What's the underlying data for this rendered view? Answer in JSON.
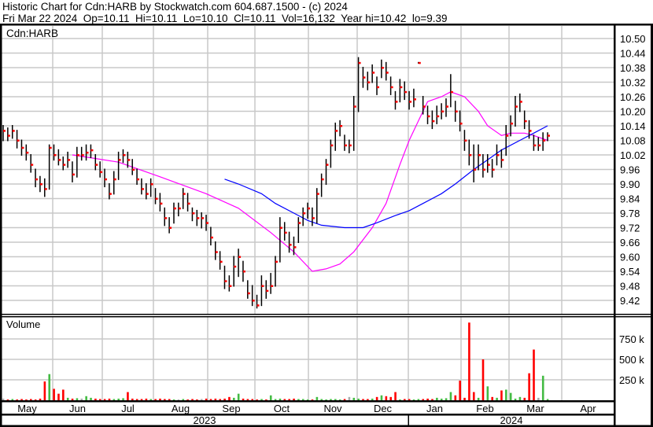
{
  "header": {
    "title": "Historic Chart for Cdn:HARB by Stockwatch.com 604.687.1500 - (c) 2024",
    "quote": "Fri Mar 22 2024  Op=10.11  Hi=10.11  Lo=10.10  Cl=10.11  Vol=16,132  Year hi=10.42  lo=9.39"
  },
  "chart_data": {
    "type": "ohlc",
    "symbol_label": "Cdn:HARB",
    "volume_label": "Volume",
    "price_axis": {
      "ylim": [
        9.36,
        10.56
      ],
      "ticks": [
        "10.50",
        "10.44",
        "10.38",
        "10.32",
        "10.26",
        "10.20",
        "10.14",
        "10.08",
        "10.02",
        "9.96",
        "9.90",
        "9.84",
        "9.78",
        "9.72",
        "9.66",
        "9.60",
        "9.54",
        "9.48",
        "9.42"
      ],
      "side": "right",
      "grid": true
    },
    "volume_axis": {
      "ylim_k": [
        0,
        1000
      ],
      "ticks": [
        {
          "value": 750,
          "label": "750 k"
        },
        {
          "value": 500,
          "label": "500 k"
        },
        {
          "value": 250,
          "label": "250 k"
        }
      ]
    },
    "months": [
      "May",
      "Jun",
      "Jul",
      "Aug",
      "Sep",
      "Oct",
      "Nov",
      "Dec",
      "Jan",
      "Feb",
      "Mar",
      "Apr"
    ],
    "years": [
      "2023",
      "2024"
    ],
    "colors": {
      "close_tick": "#ff0000",
      "bar": "#000000",
      "ma_short": "#ff00ff",
      "ma_long": "#0000ff",
      "vol_up": "#44bb44",
      "vol_down": "#ff0000",
      "vol_flat": "#aaaaaa",
      "grid": "#c8c8c8"
    },
    "bars_hlc": [
      [
        10.14,
        10.08,
        10.12
      ],
      [
        10.13,
        10.08,
        10.1
      ],
      [
        10.14,
        10.09,
        10.12
      ],
      [
        10.12,
        10.05,
        10.08
      ],
      [
        10.08,
        10.02,
        10.05
      ],
      [
        10.06,
        10.0,
        10.03
      ],
      [
        10.02,
        9.95,
        9.98
      ],
      [
        9.96,
        9.89,
        9.92
      ],
      [
        9.93,
        9.87,
        9.9
      ],
      [
        9.92,
        9.85,
        9.88
      ],
      [
        10.06,
        9.88,
        10.05
      ],
      [
        10.06,
        10.0,
        10.02
      ],
      [
        10.04,
        9.98,
        10.0
      ],
      [
        10.01,
        9.96,
        9.98
      ],
      [
        10.03,
        9.97,
        10.0
      ],
      [
        9.99,
        9.91,
        9.94
      ],
      [
        10.05,
        9.93,
        10.02
      ],
      [
        10.05,
        10.0,
        10.02
      ],
      [
        10.06,
        10.0,
        10.03
      ],
      [
        10.06,
        10.01,
        10.04
      ],
      [
        10.02,
        9.96,
        9.98
      ],
      [
        9.99,
        9.93,
        9.95
      ],
      [
        9.96,
        9.89,
        9.92
      ],
      [
        9.9,
        9.84,
        9.86
      ],
      [
        9.95,
        9.86,
        9.92
      ],
      [
        10.03,
        9.92,
        10.0
      ],
      [
        10.04,
        9.99,
        10.02
      ],
      [
        10.03,
        9.97,
        10.0
      ],
      [
        10.0,
        9.94,
        9.96
      ],
      [
        9.96,
        9.9,
        9.92
      ],
      [
        9.92,
        9.86,
        9.88
      ],
      [
        9.9,
        9.84,
        9.86
      ],
      [
        9.92,
        9.85,
        9.9
      ],
      [
        9.88,
        9.82,
        9.84
      ],
      [
        9.86,
        9.79,
        9.82
      ],
      [
        9.8,
        9.73,
        9.76
      ],
      [
        9.76,
        9.7,
        9.72
      ],
      [
        9.82,
        9.74,
        9.8
      ],
      [
        9.82,
        9.77,
        9.8
      ],
      [
        9.88,
        9.8,
        9.86
      ],
      [
        9.86,
        9.79,
        9.82
      ],
      [
        9.8,
        9.75,
        9.78
      ],
      [
        9.79,
        9.73,
        9.76
      ],
      [
        9.78,
        9.72,
        9.76
      ],
      [
        9.77,
        9.71,
        9.74
      ],
      [
        9.72,
        9.65,
        9.68
      ],
      [
        9.66,
        9.59,
        9.62
      ],
      [
        9.62,
        9.55,
        9.58
      ],
      [
        9.56,
        9.47,
        9.5
      ],
      [
        9.52,
        9.46,
        9.48
      ],
      [
        9.6,
        9.48,
        9.56
      ],
      [
        9.63,
        9.52,
        9.6
      ],
      [
        9.58,
        9.5,
        9.54
      ],
      [
        9.5,
        9.43,
        9.45
      ],
      [
        9.48,
        9.4,
        9.42
      ],
      [
        9.44,
        9.39,
        9.4
      ],
      [
        9.52,
        9.4,
        9.48
      ],
      [
        9.5,
        9.43,
        9.46
      ],
      [
        9.53,
        9.45,
        9.48
      ],
      [
        9.6,
        9.48,
        9.58
      ],
      [
        9.76,
        9.58,
        9.72
      ],
      [
        9.74,
        9.67,
        9.7
      ],
      [
        9.7,
        9.62,
        9.65
      ],
      [
        9.68,
        9.61,
        9.64
      ],
      [
        9.76,
        9.66,
        9.74
      ],
      [
        9.8,
        9.73,
        9.78
      ],
      [
        9.82,
        9.76,
        9.8
      ],
      [
        9.8,
        9.73,
        9.76
      ],
      [
        9.88,
        9.74,
        9.86
      ],
      [
        9.94,
        9.85,
        9.92
      ],
      [
        10.0,
        9.9,
        9.98
      ],
      [
        10.08,
        9.97,
        10.06
      ],
      [
        10.15,
        10.04,
        10.12
      ],
      [
        10.16,
        10.1,
        10.14
      ],
      [
        10.1,
        10.04,
        10.06
      ],
      [
        10.08,
        10.03,
        10.06
      ],
      [
        10.26,
        10.04,
        10.22
      ],
      [
        10.42,
        10.2,
        10.4
      ],
      [
        10.38,
        10.3,
        10.34
      ],
      [
        10.36,
        10.29,
        10.32
      ],
      [
        10.39,
        10.32,
        10.36
      ],
      [
        10.34,
        10.27,
        10.3
      ],
      [
        10.41,
        10.34,
        10.38
      ],
      [
        10.4,
        10.33,
        10.36
      ],
      [
        10.34,
        10.27,
        10.3
      ],
      [
        10.28,
        10.21,
        10.24
      ],
      [
        10.33,
        10.24,
        10.3
      ],
      [
        10.32,
        10.25,
        10.28
      ],
      [
        10.28,
        10.21,
        10.24
      ],
      [
        10.29,
        10.22,
        10.25
      ],
      [
        10.4,
        10.4,
        10.4
      ],
      [
        10.26,
        10.19,
        10.22
      ],
      [
        10.22,
        10.15,
        10.18
      ],
      [
        10.2,
        10.13,
        10.16
      ],
      [
        10.22,
        10.15,
        10.18
      ],
      [
        10.23,
        10.17,
        10.2
      ],
      [
        10.25,
        10.18,
        10.22
      ],
      [
        10.35,
        10.22,
        10.28
      ],
      [
        10.24,
        10.16,
        10.2
      ],
      [
        10.2,
        10.12,
        10.15
      ],
      [
        10.12,
        10.04,
        10.08
      ],
      [
        10.08,
        9.98,
        10.02
      ],
      [
        10.06,
        9.91,
        9.96
      ],
      [
        10.06,
        9.96,
        10.02
      ],
      [
        10.02,
        9.93,
        9.96
      ],
      [
        10.02,
        9.95,
        9.98
      ],
      [
        10.0,
        9.93,
        9.96
      ],
      [
        10.06,
        9.98,
        10.02
      ],
      [
        10.04,
        9.97,
        10.0
      ],
      [
        10.14,
        10.02,
        10.1
      ],
      [
        10.18,
        10.1,
        10.15
      ],
      [
        10.26,
        10.14,
        10.22
      ],
      [
        10.27,
        10.2,
        10.24
      ],
      [
        10.2,
        10.13,
        10.16
      ],
      [
        10.16,
        10.09,
        10.12
      ],
      [
        10.1,
        10.04,
        10.06
      ],
      [
        10.09,
        10.04,
        10.06
      ],
      [
        10.11,
        10.04,
        10.08
      ],
      [
        10.11,
        10.08,
        10.1
      ]
    ],
    "volume_k": [
      20,
      10,
      15,
      10,
      15,
      10,
      15,
      10,
      20,
      230,
      320,
      140,
      80,
      130,
      30,
      20,
      25,
      20,
      50,
      30,
      20,
      15,
      15,
      20,
      15,
      20,
      25,
      100,
      20,
      15,
      15,
      20,
      15,
      15,
      20,
      15,
      15,
      10,
      10,
      15,
      10,
      15,
      10,
      15,
      20,
      15,
      20,
      15,
      20,
      40,
      30,
      80,
      20,
      15,
      15,
      10,
      15,
      10,
      60,
      15,
      20,
      15,
      15,
      20,
      15,
      15,
      10,
      10,
      40,
      15,
      10,
      15,
      15,
      10,
      15,
      40,
      30,
      20,
      15,
      15,
      20,
      40,
      60,
      50,
      40,
      100,
      10,
      15,
      15,
      10,
      15,
      15,
      20,
      15,
      30,
      20,
      25,
      100,
      60,
      240,
      30,
      950,
      100,
      30,
      500,
      170,
      40,
      30,
      120,
      130,
      90,
      20,
      40,
      30,
      330,
      620,
      30,
      300,
      15
    ],
    "ma_short": [
      [
        15,
        10.02
      ],
      [
        25,
        9.99
      ],
      [
        34,
        9.93
      ],
      [
        44,
        9.86
      ],
      [
        51,
        9.8
      ],
      [
        58,
        9.7
      ],
      [
        63,
        9.62
      ],
      [
        67,
        9.54
      ],
      [
        70,
        9.55
      ],
      [
        73,
        9.57
      ],
      [
        76,
        9.62
      ],
      [
        80,
        9.72
      ],
      [
        83,
        9.82
      ],
      [
        86,
        9.98
      ],
      [
        88,
        10.08
      ],
      [
        90,
        10.16
      ],
      [
        92,
        10.24
      ],
      [
        95,
        10.26
      ],
      [
        97,
        10.28
      ],
      [
        100,
        10.26
      ],
      [
        103,
        10.2
      ],
      [
        105,
        10.14
      ],
      [
        108,
        10.1
      ],
      [
        110,
        10.11
      ],
      [
        113,
        10.11
      ],
      [
        115,
        10.1
      ],
      [
        118,
        10.08
      ]
    ],
    "ma_long": [
      [
        48,
        9.92
      ],
      [
        51,
        9.9
      ],
      [
        56,
        9.86
      ],
      [
        59,
        9.82
      ],
      [
        63,
        9.78
      ],
      [
        66,
        9.75
      ],
      [
        69,
        9.73
      ],
      [
        74,
        9.72
      ],
      [
        78,
        9.72
      ],
      [
        81,
        9.74
      ],
      [
        85,
        9.77
      ],
      [
        88,
        9.79
      ],
      [
        91,
        9.82
      ],
      [
        95,
        9.86
      ],
      [
        98,
        9.9
      ],
      [
        102,
        9.96
      ],
      [
        105,
        10.0
      ],
      [
        108,
        10.04
      ],
      [
        112,
        10.08
      ],
      [
        115,
        10.11
      ],
      [
        118,
        10.14
      ]
    ]
  }
}
